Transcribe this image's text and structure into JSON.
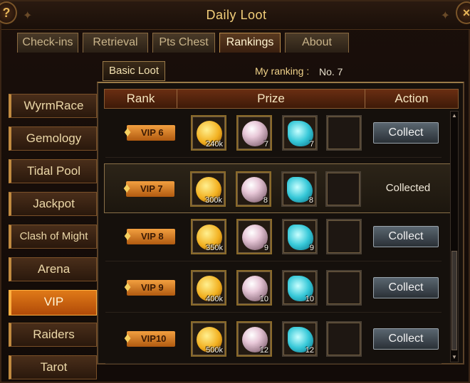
{
  "window": {
    "title": "Daily Loot",
    "help_icon": "?",
    "close_icon": "×"
  },
  "tabs": [
    {
      "label": "Check-ins",
      "active": false
    },
    {
      "label": "Retrieval",
      "active": false
    },
    {
      "label": "Pts Chest",
      "active": false
    },
    {
      "label": "Rankings",
      "active": true
    },
    {
      "label": "About",
      "active": false
    }
  ],
  "subtab": {
    "label": "Basic Loot"
  },
  "my_ranking": {
    "label": "My ranking :",
    "value": "No. 7"
  },
  "sidebar": [
    {
      "label": "WyrmRace",
      "active": false
    },
    {
      "label": "Gemology",
      "active": false
    },
    {
      "label": "Tidal Pool",
      "active": false
    },
    {
      "label": "Jackpot",
      "active": false
    },
    {
      "label": "Clash of Might",
      "active": false
    },
    {
      "label": "Arena",
      "active": false
    },
    {
      "label": "VIP",
      "active": true
    },
    {
      "label": "Raiders",
      "active": false
    },
    {
      "label": "Tarot",
      "active": false
    }
  ],
  "table": {
    "headers": {
      "rank": "Rank",
      "prize": "Prize",
      "action": "Action"
    },
    "rows": [
      {
        "rank": "VIP 6",
        "coin": "240k",
        "pearl": "7",
        "potion": "7",
        "action": "Collect",
        "collected": false
      },
      {
        "rank": "VIP 7",
        "coin": "300k",
        "pearl": "8",
        "potion": "8",
        "action": "Collected",
        "collected": true
      },
      {
        "rank": "VIP 8",
        "coin": "350k",
        "pearl": "9",
        "potion": "9",
        "action": "Collect",
        "collected": false
      },
      {
        "rank": "VIP 9",
        "coin": "400k",
        "pearl": "10",
        "potion": "10",
        "action": "Collect",
        "collected": false
      },
      {
        "rank": "VIP10",
        "coin": "500k",
        "pearl": "12",
        "potion": "12",
        "action": "Collect",
        "collected": false
      }
    ]
  },
  "icons": {
    "vip_shield": "shield-icon",
    "coin": "gold-coin-icon",
    "pearl": "pearl-icon",
    "potion": "potion-icon",
    "scroll_up": "arrow-up-icon",
    "scroll_down": "arrow-down-icon"
  },
  "colors": {
    "accent": "#e07a18",
    "title": "#f3cf7a",
    "panel_header": "#6a2e12"
  }
}
